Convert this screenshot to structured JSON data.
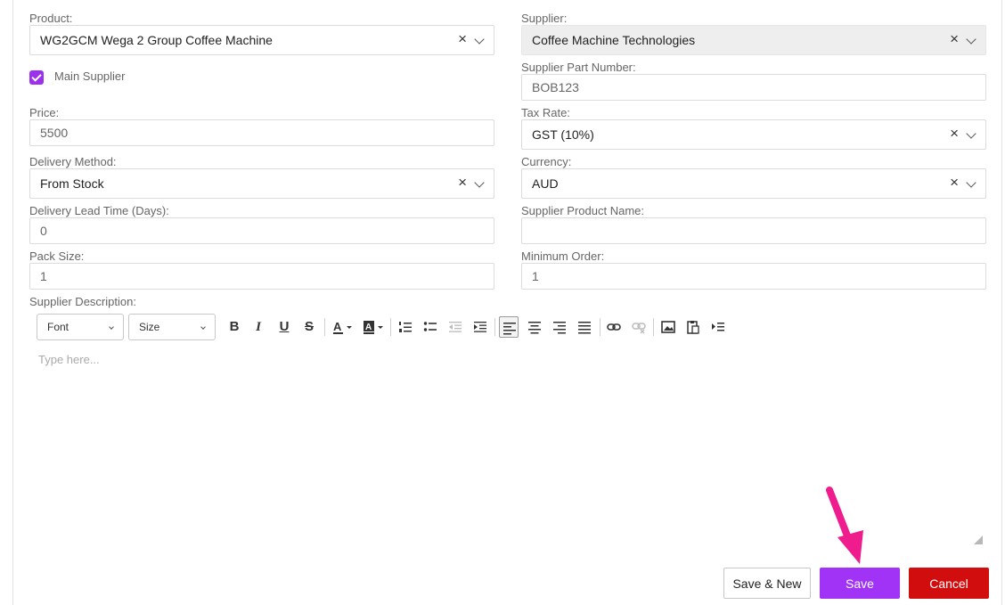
{
  "form": {
    "product": {
      "label": "Product:",
      "value": "WG2GCM Wega 2 Group Coffee Machine"
    },
    "supplier": {
      "label": "Supplier:",
      "value": "Coffee Machine Technologies"
    },
    "main_supplier": {
      "label": "Main Supplier",
      "checked": true
    },
    "supplier_part_number": {
      "label": "Supplier Part Number:",
      "value": "BOB123"
    },
    "price": {
      "label": "Price:",
      "value": "5500"
    },
    "tax_rate": {
      "label": "Tax Rate:",
      "value": "GST (10%)"
    },
    "delivery_method": {
      "label": "Delivery Method:",
      "value": "From Stock"
    },
    "currency": {
      "label": "Currency:",
      "value": "AUD"
    },
    "delivery_lead_time": {
      "label": "Delivery Lead Time (Days):",
      "value": "0"
    },
    "supplier_product_name": {
      "label": "Supplier Product Name:",
      "value": ""
    },
    "pack_size": {
      "label": "Pack Size:",
      "value": "1"
    },
    "minimum_order": {
      "label": "Minimum Order:",
      "value": "1"
    },
    "supplier_description": {
      "label": "Supplier Description:",
      "placeholder": "Type here..."
    }
  },
  "toolbar": {
    "font_label": "Font",
    "size_label": "Size",
    "bold": "B",
    "italic": "I",
    "underline": "U",
    "strikethrough": "S"
  },
  "actions": {
    "save_new": "Save & New",
    "save": "Save",
    "cancel": "Cancel"
  },
  "colors": {
    "accent": "#a033f5",
    "danger": "#d20d0d",
    "annotation_arrow": "#ee1c8c"
  },
  "icons": {
    "clear": "×"
  }
}
